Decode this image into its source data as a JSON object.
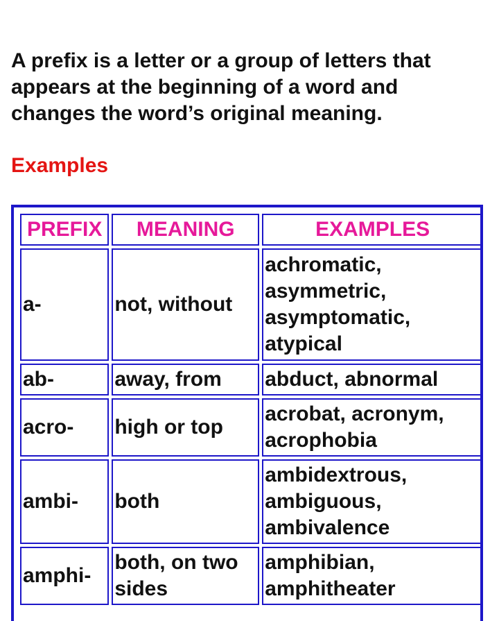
{
  "intro": {
    "lines": [
      "A prefix is a letter or a group of letters that",
      "appears at the beginning of a word and",
      "changes the word’s original meaning."
    ]
  },
  "examples_heading": "Examples",
  "colors": {
    "heading_red": "#e41513",
    "header_magenta": "#e6199a",
    "border_blue": "#1d17c9",
    "text": "#111111"
  },
  "table": {
    "headers": [
      "PREFIX",
      "MEANING",
      "EXAMPLES"
    ],
    "rows": [
      {
        "prefix": "a-",
        "meaning": [
          "not, without"
        ],
        "examples": [
          "achromatic,",
          "asymmetric,",
          "asymptomatic,",
          "atypical"
        ]
      },
      {
        "prefix": "ab-",
        "meaning": [
          "away, from"
        ],
        "examples": [
          "abduct, abnormal"
        ]
      },
      {
        "prefix": "acro-",
        "meaning": [
          "high or top"
        ],
        "examples": [
          "acrobat, acronym,",
          "acrophobia"
        ]
      },
      {
        "prefix": "ambi-",
        "meaning": [
          "both"
        ],
        "examples": [
          "ambidextrous,",
          "ambiguous,",
          "ambivalence"
        ]
      },
      {
        "prefix": "amphi-",
        "meaning": [
          "both, on two",
          "sides"
        ],
        "examples": [
          "amphibian,",
          "amphitheater"
        ]
      }
    ]
  }
}
